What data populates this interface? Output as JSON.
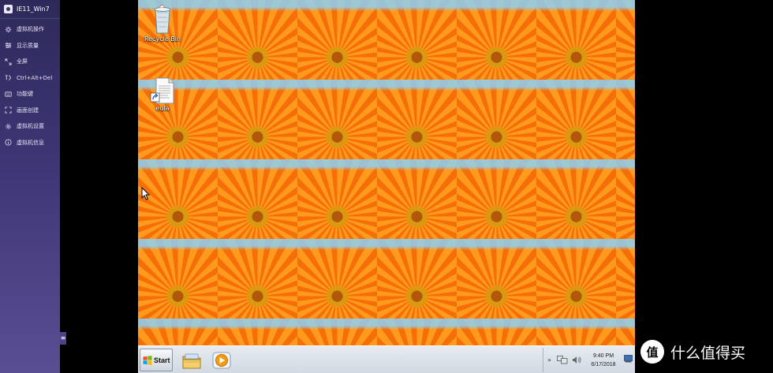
{
  "sidebar": {
    "title": "IE11_Win7",
    "items": [
      {
        "label": "虚拟机操作",
        "icon": "vm-ops-icon"
      },
      {
        "label": "显示质量",
        "icon": "display-quality-icon"
      },
      {
        "label": "全屏",
        "icon": "fullscreen-icon"
      },
      {
        "label": "Ctrl+Alt+Del",
        "icon": "keyboard-combo-icon"
      },
      {
        "label": "功能键",
        "icon": "function-keys-icon"
      },
      {
        "label": "画面创建",
        "icon": "screen-create-icon"
      },
      {
        "label": "虚拟机设置",
        "icon": "gear-icon"
      },
      {
        "label": "虚拟机信息",
        "icon": "info-icon"
      }
    ],
    "toggle_glyph": "≡"
  },
  "desktop": {
    "icons": [
      {
        "label": "Recycle Bin",
        "icon": "recycle-bin-icon"
      },
      {
        "label": "eula",
        "icon": "text-document-shortcut-icon"
      }
    ]
  },
  "taskbar": {
    "start_label": "Start",
    "apps": [
      "windows-explorer-icon",
      "media-player-icon"
    ],
    "tray": {
      "chevron": "»",
      "time": "9:40 PM",
      "date": "6/17/2018"
    }
  },
  "watermark": {
    "badge_glyph": "值",
    "text": "什么值得买"
  },
  "colors": {
    "sidebar_top": "#2d2a5a",
    "sidebar_bottom": "#5a4e93",
    "desktop_orange": "#f18a12",
    "sky_blue": "#7cc9f2",
    "taskbar": "#dce2e9"
  }
}
